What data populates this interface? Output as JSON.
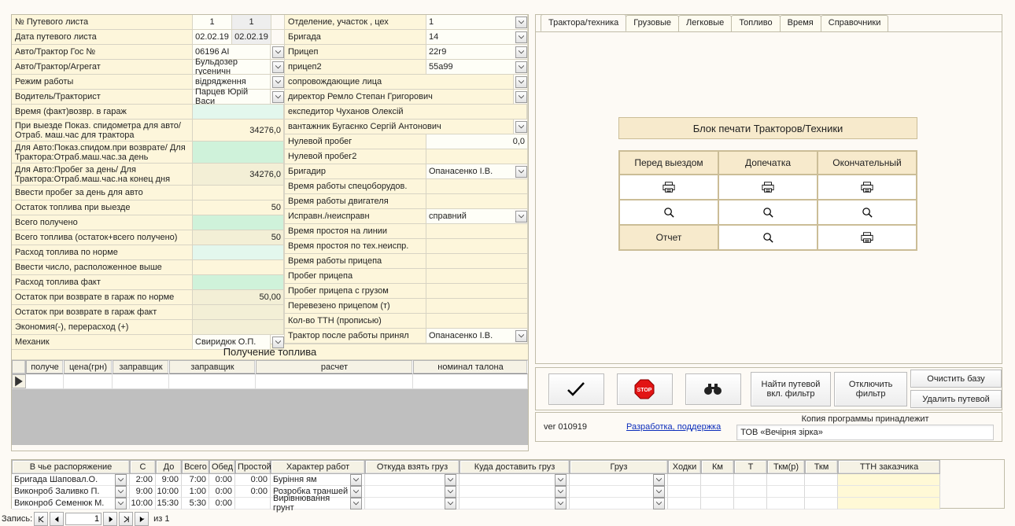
{
  "left": {
    "rows": [
      {
        "k": "№ Путевого листа",
        "v1": "1",
        "v2": "1",
        "bg": "pale"
      },
      {
        "k": "Дата путевого листа",
        "v1": "02.02.19",
        "v2": "02.02.19",
        "bg": "pale"
      },
      {
        "k": "Авто/Трактор Гос №",
        "vfull": "06196 AI",
        "dd": true,
        "bg": "pale"
      },
      {
        "k": "Авто/Трактор/Агрегат",
        "vfull": "Бульдозер гусеничн",
        "dd": true,
        "bg": "pale"
      },
      {
        "k": "Режим работы",
        "vfull": "відрядження",
        "dd": true,
        "bg": "pale"
      },
      {
        "k": "Водитель/Тракторист",
        "vfull": "Парцев Юрій Васи",
        "dd": true,
        "bg": "pale"
      },
      {
        "k": "Время (факт)возвр. в гараж",
        "vfull": "",
        "bg": "mint"
      },
      {
        "k": "При выезде Показ. спидометра для авто/ Отраб. маш.час для трактора",
        "vfull": "34276,0",
        "bg": "cream",
        "tall": true,
        "rt": true
      },
      {
        "k": "Для Авто:Показ.спидом.при возврате/ Для Трактора:Отраб.маш.час.за день",
        "vfull": "",
        "bg": "green",
        "tall": true
      },
      {
        "k": "Для Авто:Пробег за день/ Для Трактора:Отраб.маш.час.на конец дня",
        "vfull": "34276,0",
        "bg": "beige",
        "tall": true,
        "rt": true
      },
      {
        "k": "Ввести пробег за день для авто",
        "vfull": "",
        "bg": "cream"
      },
      {
        "k": "Остаток топлива при выезде",
        "vfull": "50",
        "bg": "cream",
        "rt": true
      },
      {
        "k": "Всего получено",
        "vfull": "",
        "bg": "green"
      },
      {
        "k": "Всего топлива (остаток+всего получено)",
        "vfull": "50",
        "bg": "beige",
        "rt": true
      },
      {
        "k": "Расход топлива по норме",
        "vfull": "",
        "bg": "mint"
      },
      {
        "k": "Ввести число, расположенное выше",
        "vfull": "",
        "bg": "cream"
      },
      {
        "k": "Расход топлива факт",
        "vfull": "",
        "bg": "green"
      },
      {
        "k": "Остаток при возврате в гараж по норме",
        "vfull": "50,00",
        "bg": "beige",
        "rt": true
      },
      {
        "k": "Остаток при возврате в гараж  факт",
        "vfull": "",
        "bg": "beige"
      },
      {
        "k": "Экономия(-), перерасход (+)",
        "vfull": "",
        "bg": "beige"
      },
      {
        "k": "Механик",
        "vfull": "Свиридюк О.П.",
        "dd": true,
        "bg": "pale"
      }
    ],
    "right_rows": [
      {
        "k": "Отделение, участок , цех",
        "v": "1",
        "dd": true
      },
      {
        "k": "Бригада",
        "v": "14",
        "dd": true
      },
      {
        "k": "Прицеп",
        "v": "22г9",
        "dd": true
      },
      {
        "k": "прицеп2",
        "v": "55a99",
        "dd": true
      },
      {
        "k": "сопровождающие лица",
        "v": "",
        "dd": true,
        "span_label": true
      },
      {
        "k": "директор Ремло Степан Григорович",
        "v": "",
        "dd": true,
        "span_label": true
      },
      {
        "k": "експедитор Чуханов Олексій",
        "v": "",
        "span_label": true,
        "no_dd": true
      },
      {
        "k": "вантажник Бугаєнко Сергій Антонович",
        "v": "",
        "dd": true,
        "span_label": true
      },
      {
        "k": "Нулевой пробег",
        "v": "0,0",
        "rt": true
      },
      {
        "k": "Нулевой пробег2",
        "v": "",
        "cream": true
      },
      {
        "k": "Бригадир",
        "v": "Опанасенко І.В.",
        "dd": true
      },
      {
        "k": "Время работы спецоборудов.",
        "v": "",
        "cream": true
      },
      {
        "k": "Время работы двигателя",
        "v": "",
        "cream": true
      },
      {
        "k": "Исправн./неисправн",
        "v": "справний",
        "dd": true
      },
      {
        "k": "Время простоя на линии",
        "v": "",
        "cream": true
      },
      {
        "k": "Время простоя по тех.неиспр.",
        "v": "",
        "cream": true
      },
      {
        "k": "Время работы прицепа",
        "v": "",
        "cream": true
      },
      {
        "k": "Пробег прицепа",
        "v": "",
        "cream": true
      },
      {
        "k": "Пробег прицепа с грузом",
        "v": "",
        "cream": true
      },
      {
        "k": "Перевезено прицепом (т)",
        "v": "",
        "cream": true
      },
      {
        "k": "Кол-во ТТН (прописью)",
        "v": "",
        "cream": true
      },
      {
        "k": "Трактор после работы принял",
        "v": "Опанасенко І.В.",
        "dd": true
      }
    ],
    "fuel_title": "Получение топлива",
    "fuel_headers": [
      "получе",
      "цена(грн)",
      "заправщик",
      "заправщик",
      "расчет",
      "номинал талона"
    ]
  },
  "tabs": [
    "Трактора/техника",
    "Грузовые",
    "Легковые",
    "Топливо",
    "Время",
    "Справочники"
  ],
  "print": {
    "title": "Блок печати Тракторов/Техники",
    "cols": [
      "Перед выездом",
      "Допечатка",
      "Окончательный"
    ],
    "side": "Отчет"
  },
  "toolbar": {
    "find": "Найти путевой вкл. фильтр",
    "filter_off": "Отключить фильтр",
    "clear_db": "Очистить базу",
    "delete": "Удалить путевой"
  },
  "footer": {
    "ver": "ver 010919",
    "support": "Разработка, поддержка",
    "copy_label": "Копия программы принадлежит",
    "owner": "ТОВ «Вечірня зірка»"
  },
  "bottom": {
    "headers": [
      "В чье распоряжение",
      "С",
      "До",
      "Всего",
      "Обед",
      "Простой",
      "Характер работ",
      "Откуда взять груз",
      "Куда доставить груз",
      "Груз",
      "Ходки",
      "Км",
      "Т",
      "Ткм(р)",
      "Ткм",
      "ТТН заказчика"
    ],
    "widths": [
      150,
      33,
      33,
      35,
      33,
      45,
      120,
      120,
      140,
      125,
      42,
      42,
      42,
      48,
      42,
      130
    ],
    "rows": [
      {
        "c0": "Бригада Шаповал.О.",
        "c1": "2:00",
        "c2": "9:00",
        "c3": "7:00",
        "c4": "0:00",
        "c5": "0:00",
        "c6": "Буріння ям"
      },
      {
        "c0": "Виконроб Заливко П.",
        "c1": "9:00",
        "c2": "10:00",
        "c3": "1:00",
        "c4": "0:00",
        "c5": "0:00",
        "c6": "Розробка траншей"
      },
      {
        "c0": "Виконроб Семенюк М.",
        "c1": "10:00",
        "c2": "15:30",
        "c3": "5:30",
        "c4": "0:00",
        "c5": "",
        "c6": "Вирівнювання грунт"
      }
    ]
  },
  "nav": {
    "label": "Запись:",
    "pos": "1",
    "of": "из  1"
  }
}
